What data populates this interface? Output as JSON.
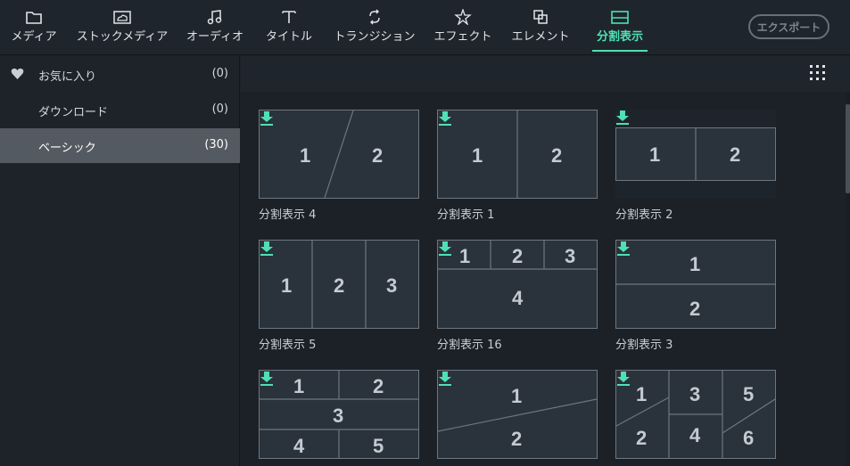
{
  "toolbar": {
    "tabs": [
      {
        "label": "メディア",
        "icon": "folder-icon"
      },
      {
        "label": "ストックメディア",
        "icon": "cloud-icon"
      },
      {
        "label": "オーディオ",
        "icon": "music-note-icon"
      },
      {
        "label": "タイトル",
        "icon": "text-icon"
      },
      {
        "label": "トランジション",
        "icon": "transition-icon"
      },
      {
        "label": "エフェクト",
        "icon": "effects-icon"
      },
      {
        "label": "エレメント",
        "icon": "elements-icon"
      },
      {
        "label": "分割表示",
        "icon": "split-screen-icon",
        "active": true
      }
    ],
    "export_label": "エクスポート"
  },
  "sidebar": {
    "items": [
      {
        "label": "お気に入り",
        "count": "(0)",
        "icon": "heart-icon"
      },
      {
        "label": "ダウンロード",
        "count": "(0)"
      },
      {
        "label": "ベーシック",
        "count": "(30)",
        "selected": true
      }
    ]
  },
  "tiles": [
    {
      "name": "分割表示 4",
      "layout": "diagonal-2"
    },
    {
      "name": "分割表示 1",
      "layout": "vertical-2"
    },
    {
      "name": "分割表示 2",
      "layout": "letterbox-2"
    },
    {
      "name": "分割表示 5",
      "layout": "vertical-3"
    },
    {
      "name": "分割表示 16",
      "layout": "three-over-one"
    },
    {
      "name": "分割表示 3",
      "layout": "horizontal-2"
    },
    {
      "name": "",
      "layout": "two-one-two"
    },
    {
      "name": "",
      "layout": "diagonal-horizontal-2"
    },
    {
      "name": "",
      "layout": "six-grid"
    }
  ],
  "colors": {
    "accent": "#4fe0b5",
    "download": "#4fe0b5"
  }
}
